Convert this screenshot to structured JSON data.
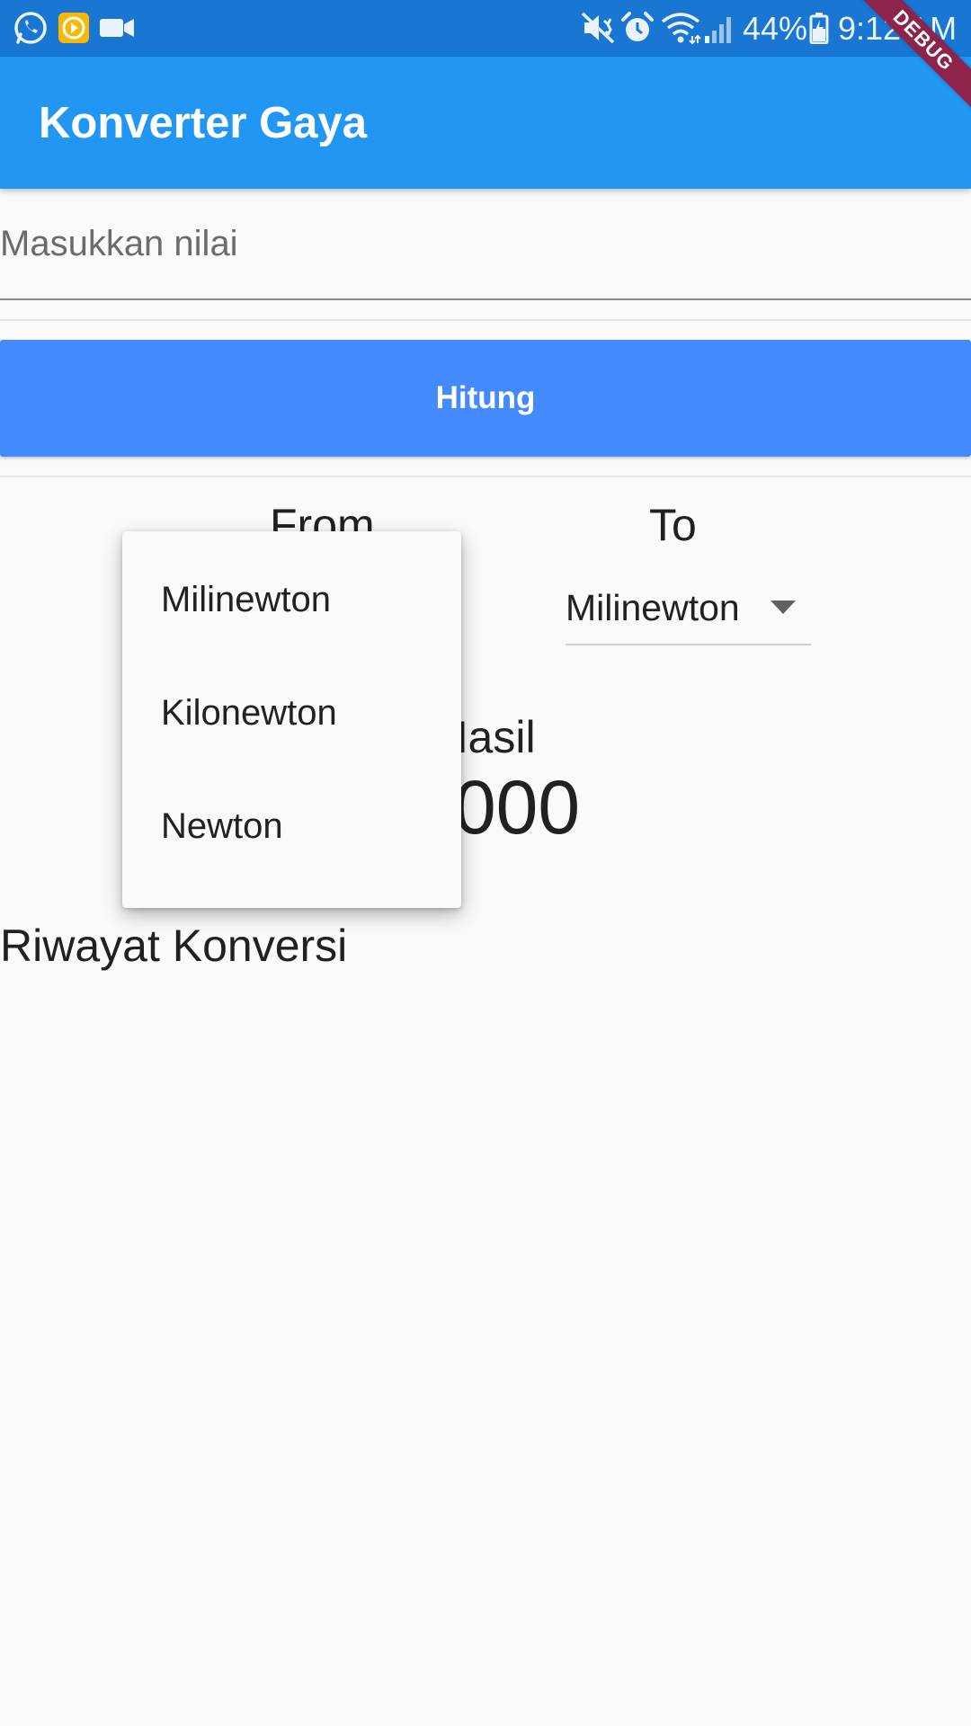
{
  "status_bar": {
    "battery_percent": "44%",
    "time": "9:12 AM",
    "icons": [
      "whatsapp-icon",
      "app-yellow-icon",
      "video-icon",
      "mute-icon",
      "alarm-icon",
      "wifi-icon",
      "signal-icon",
      "battery-icon"
    ]
  },
  "app_bar": {
    "title": "Konverter Gaya",
    "background_color": "#2196f3"
  },
  "debug_banner": "DEBUG",
  "input": {
    "placeholder": "Masukkan nilai",
    "value": ""
  },
  "calculate_button": {
    "label": "Hitung",
    "color": "#448aff"
  },
  "converter": {
    "from_label": "From",
    "to_label": "To",
    "to_selected": "Milinewton",
    "dropdown_options": [
      "Milinewton",
      "Kilonewton",
      "Newton"
    ]
  },
  "result": {
    "label": "Hasil",
    "value": "0.000"
  },
  "history": {
    "title": "Riwayat Konversi"
  }
}
